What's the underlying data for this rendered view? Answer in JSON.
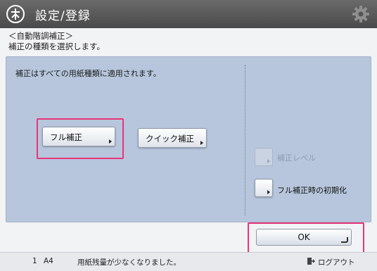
{
  "header": {
    "title": "設定/登録",
    "logo_icon": "settings-register-icon",
    "gear_icon": "gear-icon"
  },
  "subheader": {
    "breadcrumb": "＜自動階調補正＞",
    "instruction": "補正の種類を選択します。"
  },
  "panel": {
    "note": "補正はすべての用紙種類に適用されます。",
    "buttons": {
      "full": "フル補正",
      "quick": "クイック補正",
      "level": "補正レベル",
      "init": "フル補正時の初期化"
    }
  },
  "footer": {
    "ok": "OK"
  },
  "status": {
    "counter": "1",
    "paper": "A4",
    "message": "用紙残量が少なくなりました。",
    "logout": "ログアウト",
    "logout_icon": "logout-icon"
  },
  "colors": {
    "accent_highlight": "#e8357a",
    "panel": "#b7c6dc",
    "titlebar": "#4a4a4a"
  }
}
